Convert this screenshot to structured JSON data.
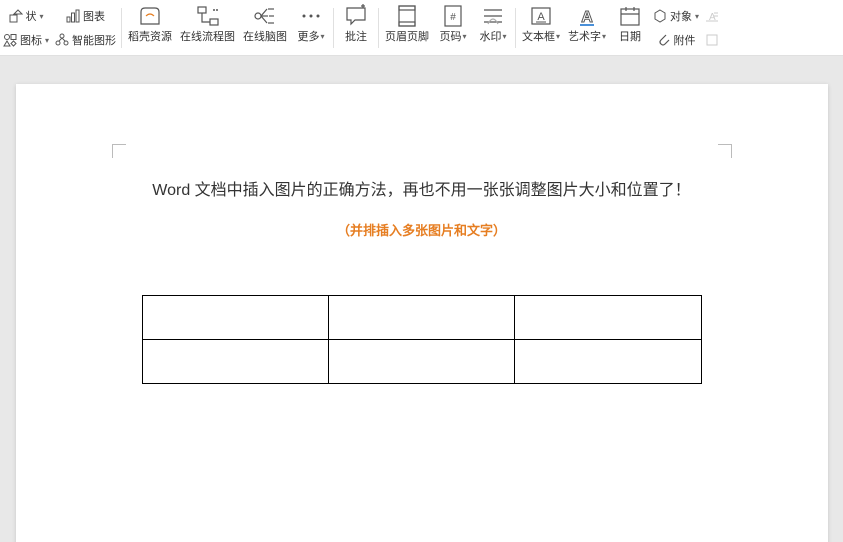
{
  "toolbar": {
    "shape": "状",
    "icon_label": "图标",
    "chart": "图表",
    "smart_graphic": "智能图形",
    "docer_resource": "稻壳资源",
    "online_flowchart": "在线流程图",
    "online_mindmap": "在线脑图",
    "more": "更多",
    "comment": "批注",
    "header_footer": "页眉页脚",
    "page_number": "页码",
    "watermark": "水印",
    "textbox": "文本框",
    "wordart": "艺术字",
    "date": "日期",
    "object": "对象",
    "attachment": "附件",
    "dropcap": "首字下沉"
  },
  "document": {
    "title": "Word 文档中插入图片的正确方法，再也不用一张张调整图片大小和位置了！",
    "subtitle": "（并排插入多张图片和文字）"
  }
}
